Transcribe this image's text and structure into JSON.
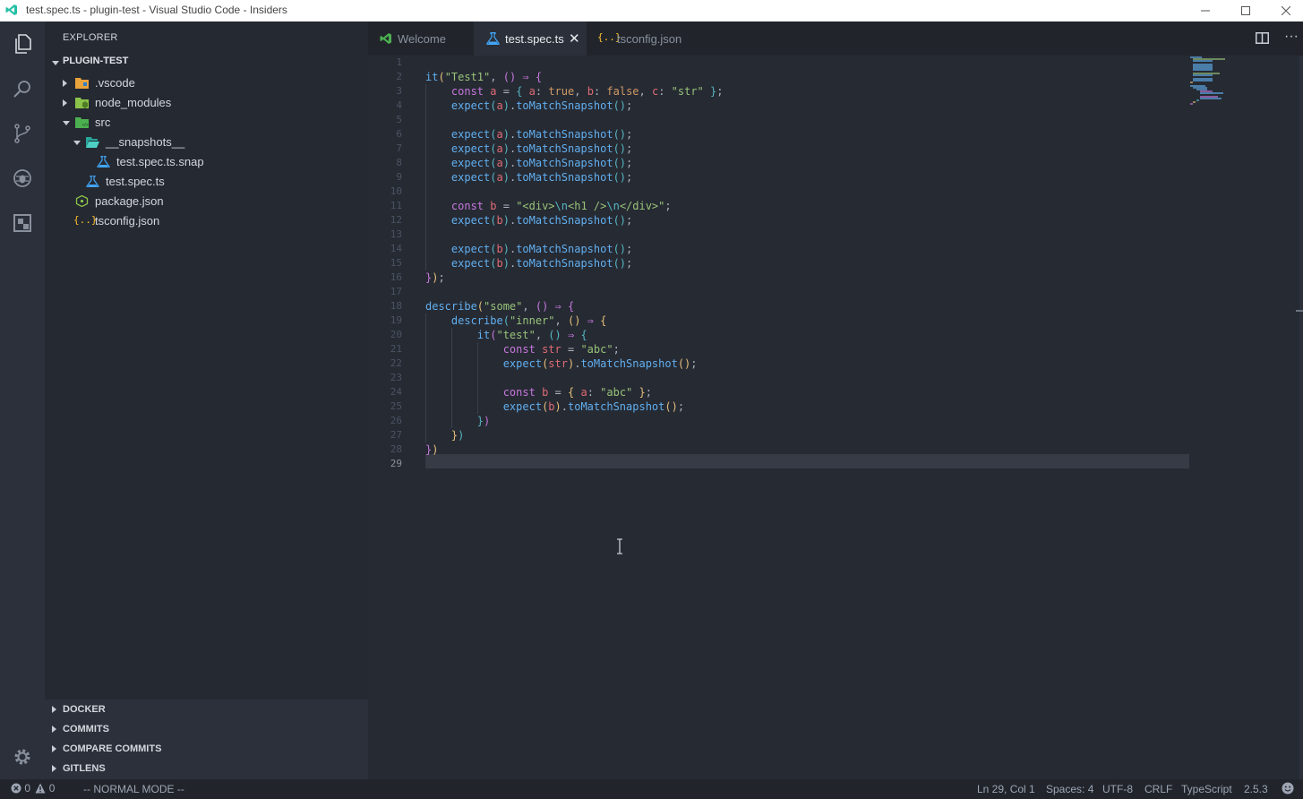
{
  "window": {
    "title": "test.spec.ts - plugin-test - Visual Studio Code - Insiders",
    "controls": [
      "minimize",
      "maximize",
      "close"
    ]
  },
  "activity_bar": {
    "items": [
      "files-icon",
      "search-icon",
      "source-control-icon",
      "debug-icon",
      "extensions-icon"
    ],
    "bottom": "gear-icon"
  },
  "explorer": {
    "header": "EXPLORER",
    "root": "PLUGIN-TEST",
    "items": [
      {
        "label": ".vscode",
        "icon": "folder-vscode-icon"
      },
      {
        "label": "node_modules",
        "icon": "folder-node-icon"
      },
      {
        "label": "src",
        "icon": "folder-src-icon"
      },
      {
        "label": "__snapshots__",
        "icon": "folder-open-icon"
      },
      {
        "label": "test.spec.ts.snap",
        "icon": "test-file-icon"
      },
      {
        "label": "test.spec.ts",
        "icon": "test-file-icon"
      },
      {
        "label": "package.json",
        "icon": "node-json-icon"
      },
      {
        "label": "tsconfig.json",
        "icon": "json-icon"
      }
    ]
  },
  "panels": {
    "docker": "DOCKER",
    "commits": "COMMITS",
    "compare_commits": "COMPARE COMMITS",
    "gitlens": "GITLENS"
  },
  "tabs": [
    {
      "label": "Welcome",
      "active": false
    },
    {
      "label": "test.spec.ts",
      "active": true
    },
    {
      "label": "tsconfig.json",
      "active": false
    }
  ],
  "editor": {
    "line_numbers": [
      "1",
      "2",
      "3",
      "4",
      "5",
      "6",
      "7",
      "8",
      "9",
      "10",
      "11",
      "12",
      "13",
      "14",
      "15",
      "16",
      "17",
      "18",
      "19",
      "20",
      "21",
      "22",
      "23",
      "24",
      "25",
      "26",
      "27",
      "28",
      "29"
    ],
    "current_line": 29
  },
  "status_bar": {
    "errors": "0",
    "warnings": "0",
    "mode": "-- NORMAL MODE --",
    "position": "Ln 29, Col 1",
    "spaces": "Spaces: 4",
    "encoding": "UTF-8",
    "eol": "CRLF",
    "language": "TypeScript",
    "version": "2.5.3"
  },
  "colors": {
    "accent": "#61afef",
    "string": "#98c379",
    "keyword": "#c678dd",
    "variable": "#e06c75",
    "background": "#262a33"
  }
}
